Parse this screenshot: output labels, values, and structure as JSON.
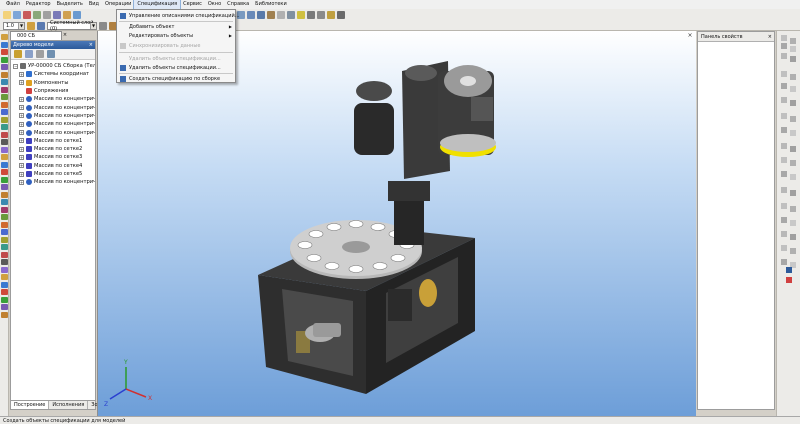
{
  "menubar": {
    "items": [
      "Файл",
      "Редактор",
      "Выделить",
      "Вид",
      "Операции",
      "Спецификация",
      "Сервис",
      "Окно",
      "Справка",
      "Библиотеки"
    ],
    "active_index": 5
  },
  "toolbar": {
    "scale_value": "1.0",
    "layer_value": "Системный слой (0)",
    "step_value": "0.2335"
  },
  "document_tab": {
    "title": "000 СБ",
    "close": "×"
  },
  "tree_panel": {
    "title": "Дерево модели",
    "close": "×",
    "items": [
      {
        "label": "УР-00000 СБ Сборка (Тел-",
        "expander": "−",
        "icon": "assembly-icon",
        "color": "#6b6b6b"
      },
      {
        "label": "Системы координат",
        "expander": "+",
        "icon": "coordinate-system-icon",
        "color": "#2f6fcf"
      },
      {
        "label": "Компоненты",
        "expander": "+",
        "icon": "component-icon",
        "color": "#e0a020"
      },
      {
        "label": "Сопряжения",
        "expander": "",
        "icon": "mate-icon",
        "color": "#d04040"
      },
      {
        "label": "Массив по концентриче",
        "expander": "+",
        "icon": "pattern-icon",
        "color": "#2f5fbf"
      },
      {
        "label": "Массив по концентриче",
        "expander": "+",
        "icon": "pattern-icon",
        "color": "#2f5fbf"
      },
      {
        "label": "Массив по концентриче",
        "expander": "+",
        "icon": "pattern-icon",
        "color": "#2f5fbf"
      },
      {
        "label": "Массив по концентриче",
        "expander": "+",
        "icon": "pattern-icon",
        "color": "#2f5fbf"
      },
      {
        "label": "Массив по концентриче",
        "expander": "+",
        "icon": "pattern-icon",
        "color": "#2f5fbf"
      },
      {
        "label": "Массив по сетке1",
        "expander": "+",
        "icon": "grid-pattern-icon",
        "color": "#3f3fbf"
      },
      {
        "label": "Массив по сетке2",
        "expander": "+",
        "icon": "grid-pattern-icon",
        "color": "#3f3fbf"
      },
      {
        "label": "Массив по сетке3",
        "expander": "+",
        "icon": "grid-pattern-icon",
        "color": "#3f3fbf"
      },
      {
        "label": "Массив по сетке4",
        "expander": "+",
        "icon": "grid-pattern-icon",
        "color": "#3f3fbf"
      },
      {
        "label": "Массив по сетке5",
        "expander": "+",
        "icon": "grid-pattern-icon",
        "color": "#3f3fbf"
      },
      {
        "label": "Массив по концентриче",
        "expander": "+",
        "icon": "pattern-icon",
        "color": "#2f5fbf"
      }
    ],
    "bottom_tabs": [
      "Построение",
      "Исполнения",
      "Зоны"
    ]
  },
  "spec_menu": {
    "items": [
      {
        "label": "Управление описаниями спецификаций...",
        "disabled": false,
        "has_sub": false,
        "icon": "spec-manage-icon"
      },
      {
        "label": "Добавить объект",
        "disabled": false,
        "has_sub": true,
        "icon": ""
      },
      {
        "label": "Редактировать объекты",
        "disabled": false,
        "has_sub": true,
        "icon": ""
      },
      {
        "label": "Синхронизировать данные",
        "disabled": true,
        "has_sub": false,
        "icon": "sync-icon"
      },
      {
        "label": "Удалить объекты спецификации...",
        "disabled": true,
        "has_sub": false,
        "icon": ""
      },
      {
        "label": "Удалить объекты спецификации...",
        "disabled": false,
        "has_sub": false,
        "icon": "delete-spec-icon"
      },
      {
        "label": "Создать спецификацию по сборке",
        "disabled": false,
        "has_sub": false,
        "icon": "create-spec-icon"
      }
    ]
  },
  "props_panel": {
    "title": "Панель свойств",
    "close": "×"
  },
  "viewport": {
    "close": "×",
    "axes": {
      "x": "X",
      "y": "Y",
      "z": "Z"
    }
  },
  "statusbar": {
    "text": "Создать объекты спецификации для моделей"
  },
  "colors": {
    "accent": "#2d5a9a",
    "viewport_top": "#ffffff",
    "viewport_bottom": "#6d9ed8",
    "motor_yellow": "#f0e000"
  }
}
